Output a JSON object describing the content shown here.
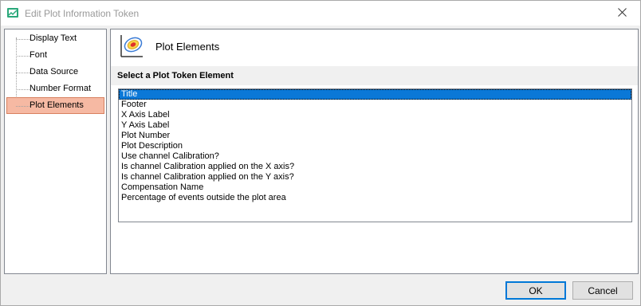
{
  "window": {
    "title": "Edit Plot Information Token",
    "close_icon": "close-icon"
  },
  "sidebar": {
    "items": [
      {
        "label": "Display Text",
        "selected": false
      },
      {
        "label": "Font",
        "selected": false
      },
      {
        "label": "Data Source",
        "selected": false
      },
      {
        "label": "Number Format",
        "selected": false
      },
      {
        "label": "Plot Elements",
        "selected": true
      }
    ]
  },
  "main": {
    "header_title": "Plot Elements",
    "header_icon": "plot-elements-icon",
    "section_label": "Select a Plot Token Element",
    "list": {
      "items": [
        "Title",
        "Footer",
        "X Axis Label",
        "Y Axis Label",
        "Plot Number",
        "Plot Description",
        "Use channel Calibration?",
        "Is channel Calibration applied on the X axis?",
        "Is channel Calibration applied on the Y axis?",
        "Compensation Name",
        "Percentage of events outside the plot area"
      ],
      "selected_index": 0
    }
  },
  "buttons": {
    "ok_label": "OK",
    "cancel_label": "Cancel"
  },
  "colors": {
    "selection_sidebar": "#f6b9a3",
    "selection_list": "#0b78d7",
    "default_button_border": "#0078d7"
  }
}
